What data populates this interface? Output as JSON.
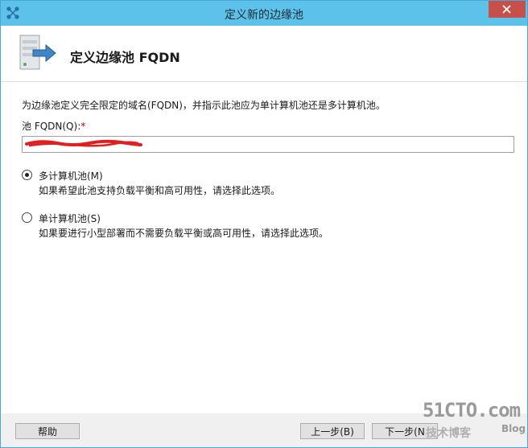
{
  "window": {
    "title": "定义新的边缘池"
  },
  "header": {
    "title": "定义边缘池 FQDN",
    "icon": "server-arrow-icon"
  },
  "content": {
    "description": "为边缘池定义完全限定的域名(FQDN)，并指示此池应为单计算机池还是多计算机池。",
    "fqdn_label": "池 FQDN(Q):",
    "fqdn_required_mark": "*",
    "fqdn_value": "",
    "options": [
      {
        "label": "多计算机池(M)",
        "description": "如果希望此池支持负载平衡和高可用性，请选择此选项。",
        "checked": true
      },
      {
        "label": "单计算机池(S)",
        "description": "如果要进行小型部署而不需要负载平衡或高可用性，请选择此选项。",
        "checked": false
      }
    ]
  },
  "footer": {
    "help_label": "帮助",
    "back_label": "上一步(B)",
    "next_label": "下一步(N"
  },
  "watermark": {
    "site": "51CTO.com",
    "tagline": "技术博客",
    "blog": "Blog"
  },
  "colors": {
    "titlebar": "#5dc2ea",
    "close_button": "#c7504b",
    "redaction": "#e02020"
  }
}
